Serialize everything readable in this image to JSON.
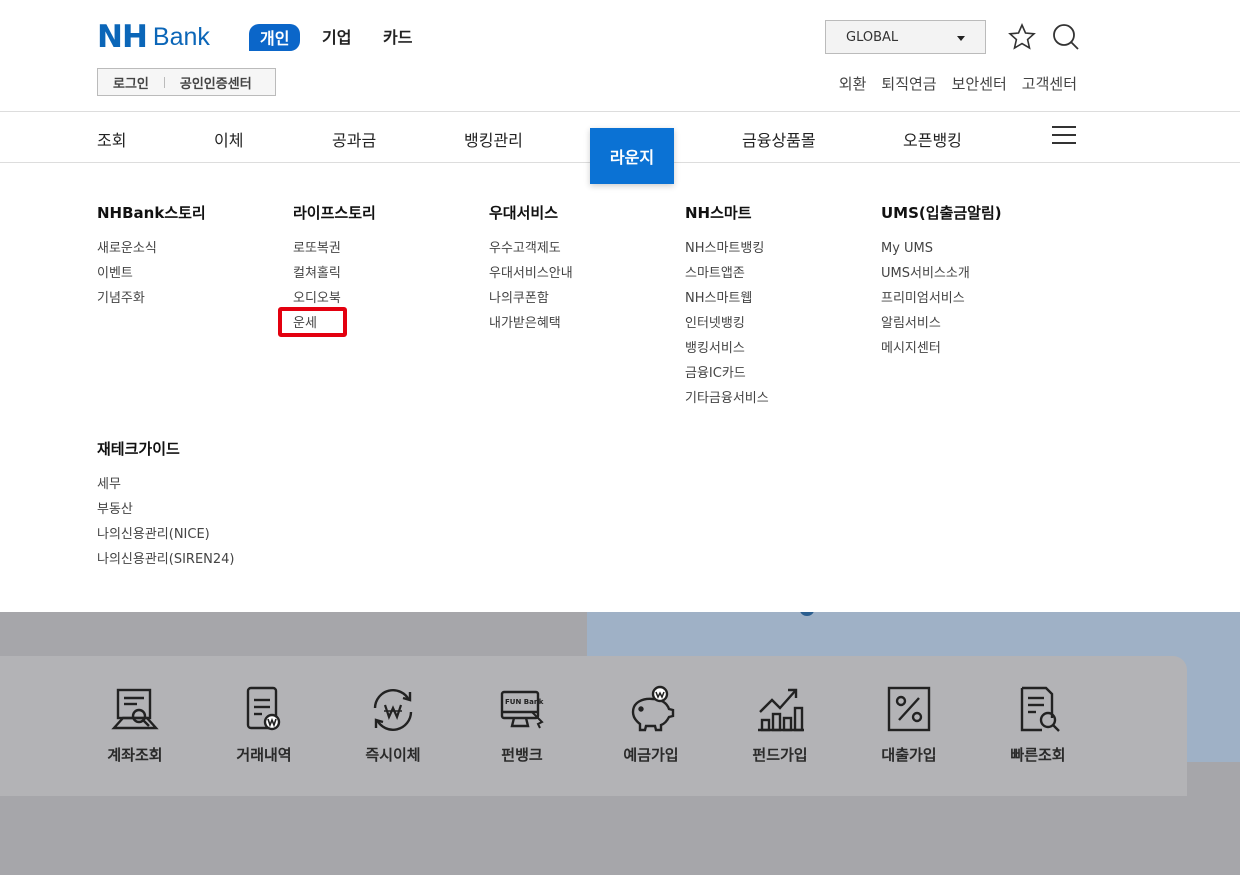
{
  "logo": {
    "nh": "NH",
    "bank": "Bank"
  },
  "segments": [
    {
      "label": "개인",
      "active": true
    },
    {
      "label": "기업",
      "active": false
    },
    {
      "label": "카드",
      "active": false
    }
  ],
  "util": {
    "login": "로그인",
    "cert": "공인인증센터"
  },
  "global": {
    "selected": "GLOBAL"
  },
  "icons": {
    "favorite": "star-icon",
    "search": "search-icon",
    "menu": "hamburger-icon"
  },
  "top_links": [
    "외환",
    "퇴직연금",
    "보안센터",
    "고객센터"
  ],
  "gnb": {
    "items": [
      "조회",
      "이체",
      "공과금",
      "뱅킹관리",
      "라운지",
      "금융상품몰",
      "오픈뱅킹"
    ],
    "active": "라운지"
  },
  "menu": [
    {
      "title": "NHBank스토리",
      "items": [
        "새로운소식",
        "이벤트",
        "기념주화"
      ]
    },
    {
      "title": "라이프스토리",
      "items": [
        "로또복권",
        "컬쳐홀릭",
        "오디오북",
        "운세"
      ]
    },
    {
      "title": "우대서비스",
      "items": [
        "우수고객제도",
        "우대서비스안내",
        "나의쿠폰함",
        "내가받은혜택"
      ]
    },
    {
      "title": "NH스마트",
      "items": [
        "NH스마트뱅킹",
        "스마트앱존",
        "NH스마트웹",
        "인터넷뱅킹",
        "뱅킹서비스",
        "금융IC카드",
        "기타금융서비스"
      ]
    },
    {
      "title": "UMS(입출금알림)",
      "items": [
        "My UMS",
        "UMS서비스소개",
        "프리미엄서비스",
        "알림서비스",
        "메시지센터"
      ]
    },
    {
      "title": "재테크가이드",
      "items": [
        "세무",
        "부동산",
        "나의신용관리(NICE)",
        "나의신용관리(SIREN24)"
      ]
    }
  ],
  "quick_menu": [
    {
      "label": "계좌조회",
      "icon": "account-search-icon"
    },
    {
      "label": "거래내역",
      "icon": "transaction-history-icon"
    },
    {
      "label": "즉시이체",
      "icon": "instant-transfer-icon"
    },
    {
      "label": "펀뱅크",
      "icon": "fun-bank-icon"
    },
    {
      "label": "예금가입",
      "icon": "piggy-bank-icon"
    },
    {
      "label": "펀드가입",
      "icon": "fund-chart-icon"
    },
    {
      "label": "대출가입",
      "icon": "percent-icon"
    },
    {
      "label": "빠른조회",
      "icon": "quick-search-icon"
    }
  ],
  "fun_bank_icon_text": "FUN Bank",
  "colors": {
    "brand": "#0b66b8",
    "active": "#0b72d4",
    "highlight": "#e3000f"
  }
}
